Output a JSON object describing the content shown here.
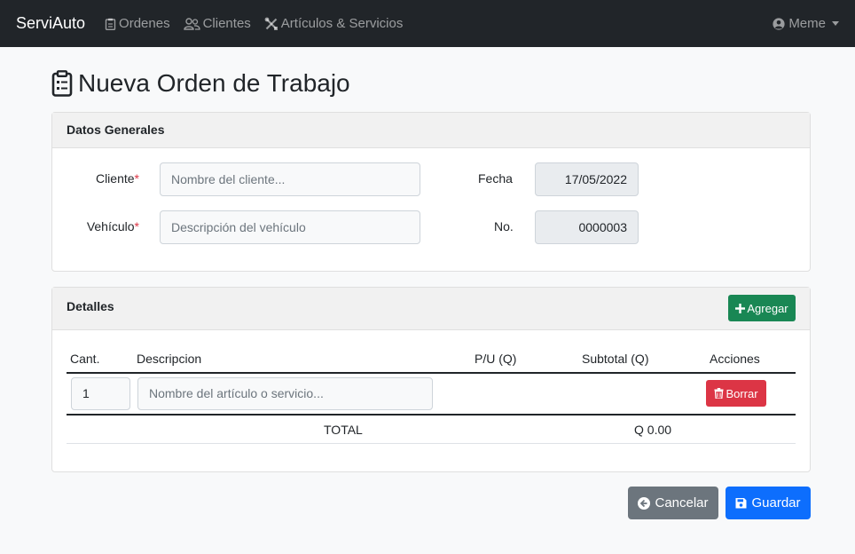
{
  "navbar": {
    "brand": "ServiAuto",
    "links": [
      {
        "label": "Ordenes",
        "icon": "clipboard-icon"
      },
      {
        "label": "Clientes",
        "icon": "people-icon"
      },
      {
        "label": "Artículos & Servicios",
        "icon": "tools-icon"
      }
    ],
    "user": "Meme"
  },
  "page": {
    "title": "Nueva Orden de Trabajo"
  },
  "general": {
    "header": "Datos Generales",
    "cliente_label": "Cliente",
    "cliente_placeholder": "Nombre del cliente...",
    "vehiculo_label": "Vehículo",
    "vehiculo_placeholder": "Descripción del vehículo",
    "fecha_label": "Fecha",
    "fecha_value": "17/05/2022",
    "no_label": "No.",
    "no_value": "0000003",
    "required_mark": "*"
  },
  "details": {
    "header": "Detalles",
    "add_label": "Agregar",
    "columns": [
      "Cant.",
      "Descripcion",
      "P/U (Q)",
      "Subtotal (Q)",
      "Acciones"
    ],
    "rows": [
      {
        "qty": "1",
        "desc_placeholder": "Nombre del artículo o servicio...",
        "delete_label": "Borrar"
      }
    ],
    "total_label": "TOTAL",
    "total_value": "Q 0.00"
  },
  "actions": {
    "cancel_label": "Cancelar",
    "save_label": "Guardar"
  },
  "colors": {
    "navbar": "#212529",
    "success": "#198754",
    "danger": "#dc3545",
    "secondary": "#6c757d",
    "primary": "#0d6efd"
  }
}
